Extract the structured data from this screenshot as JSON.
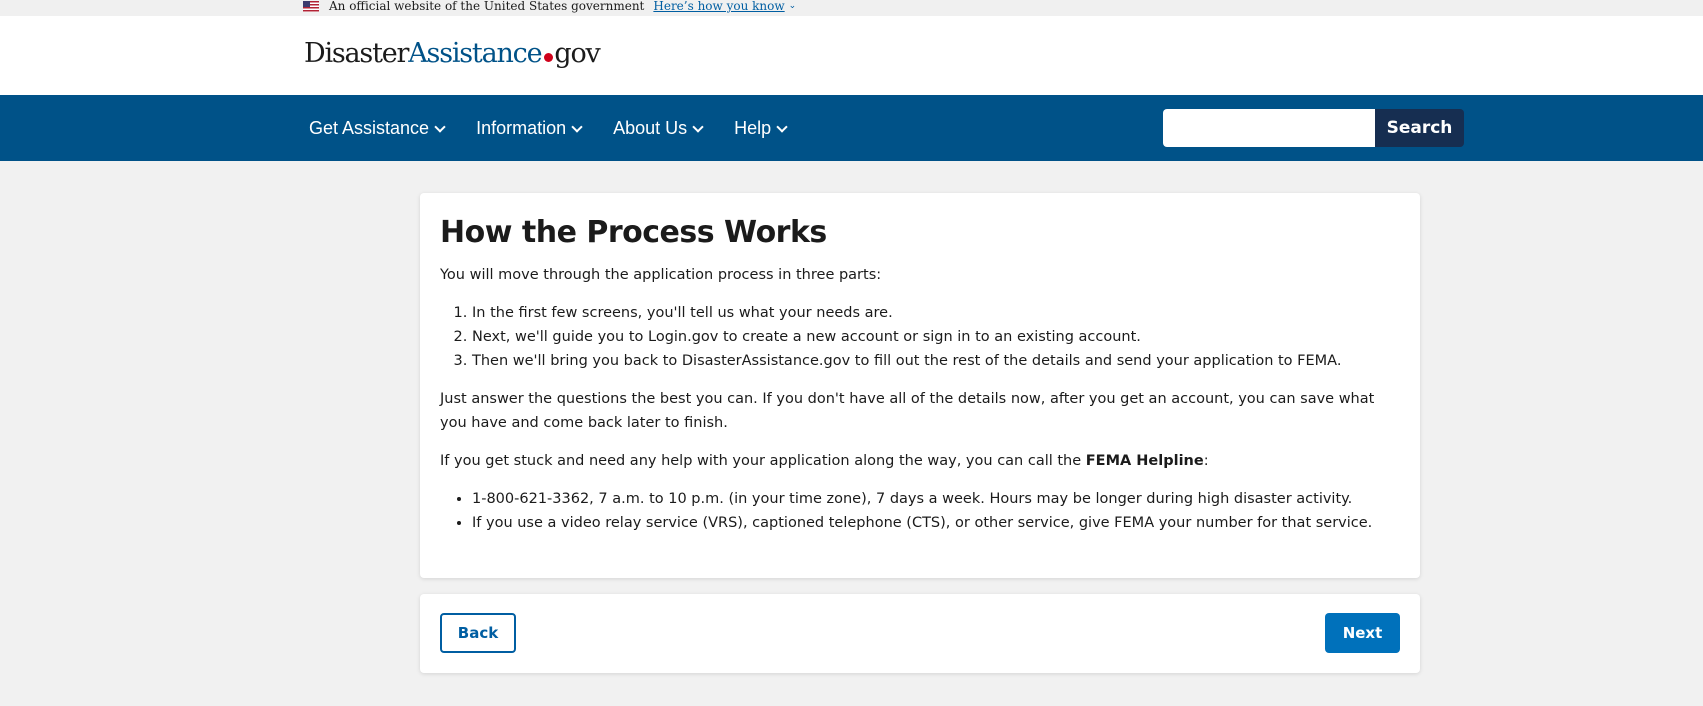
{
  "banner": {
    "text": "An official website of the United States government",
    "link": "Here’s how you know",
    "flag_icon": "us-flag-icon",
    "chevron_icon": "chevron-down-icon"
  },
  "logo": {
    "part1": "Disaster",
    "part2": "Assistance",
    "part3": "gov",
    "colors": {
      "dark": "#1b1b1b",
      "blue": "#005288",
      "dot": "#d0021b"
    }
  },
  "nav": {
    "items": [
      {
        "label": "Get Assistance"
      },
      {
        "label": "Information"
      },
      {
        "label": "About Us"
      },
      {
        "label": "Help"
      }
    ],
    "search_placeholder": "",
    "search_label": "Search",
    "colors": {
      "bar": "#005288",
      "search_button": "#162e51"
    }
  },
  "main": {
    "title": "How the Process Works",
    "intro": "You will move through the application process in three parts:",
    "steps": [
      "In the first few screens, you'll tell us what your needs are.",
      "Next, we'll guide you to Login.gov to create a new account or sign in to an existing account.",
      "Then we'll bring you back to DisasterAssistance.gov to fill out the rest of the details and send your application to FEMA."
    ],
    "para1": "Just answer the questions the best you can. If you don't have all of the details now, after you get an account, you can save what you have and come back later to finish.",
    "para2_before": "If you get stuck and need any help with your application along the way, you can call the ",
    "para2_bold": "FEMA Helpline",
    "para2_after": ":",
    "bullets": [
      "1-800-621-3362, 7 a.m. to 10 p.m. (in your time zone), 7 days a week. Hours may be longer during high disaster activity.",
      "If you use a video relay service (VRS), captioned telephone (CTS), or other service, give FEMA your number for that service."
    ]
  },
  "actions": {
    "back_label": "Back",
    "next_label": "Next",
    "colors": {
      "back_border": "#005ea2",
      "next_bg": "#0071bb"
    }
  }
}
